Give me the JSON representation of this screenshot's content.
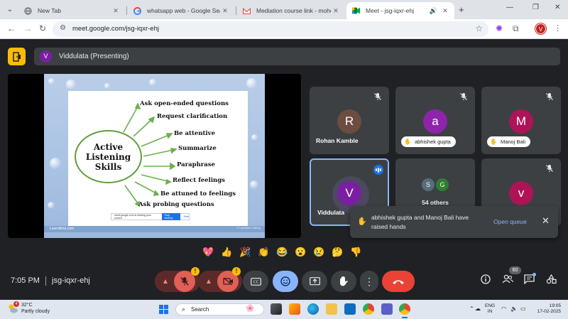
{
  "browser": {
    "tabs": [
      {
        "label": "New Tab"
      },
      {
        "label": "whatsapp web - Google Search"
      },
      {
        "label": "Mediation course link - mohod"
      },
      {
        "label": "Meet - jsg-iqxr-ehj"
      }
    ],
    "url": "meet.google.com/jsg-iqxr-ehj",
    "profile_initial": "V"
  },
  "meet": {
    "presenter_initial": "V",
    "presenter_label": "Viddulata (Presenting)",
    "slide": {
      "center_text": "Active\nListening\nSkills",
      "skills": [
        "Ask open-ended questions",
        "Request clarification",
        "Be attentive",
        "Summarize",
        "Paraphrase",
        "Reflect feelings",
        "Be attuned to feelings",
        "Ask probing questions"
      ],
      "share_bar_text": "meet.google.com is sharing your screen.",
      "share_stop": "Stop sharing",
      "share_hide": "Hide",
      "footer_left": "Learnitime.com",
      "footer_right": "© Learnitime   Training"
    },
    "participants": [
      {
        "name": "Rohan Kamble",
        "initial": "R",
        "color": "#6d4c41",
        "muted": true
      },
      {
        "name": "abhishek gupta",
        "initial": "a",
        "color": "#8e24aa",
        "muted": true,
        "hand_raised": true
      },
      {
        "name": "Manoj Bali",
        "initial": "M",
        "color": "#ad1457",
        "muted": true,
        "hand_raised": true
      },
      {
        "name": "Viddulata",
        "initial": "V",
        "color": "#7b1fa2",
        "speaking": true
      },
      {
        "name": "54 others",
        "initials": [
          "S",
          "G"
        ],
        "colors": [
          "#546e7a",
          "#2e7d32"
        ]
      },
      {
        "name": "",
        "initial": "v",
        "color": "#ad1457",
        "muted": true
      }
    ],
    "toast": {
      "message": "abhishek gupta and Manoj Bali have raised hands",
      "action": "Open queue"
    },
    "reactions": [
      "💖",
      "👍",
      "🎉",
      "👏",
      "😂",
      "😮",
      "😢",
      "🤔",
      "👎"
    ],
    "bottom": {
      "time": "7:05 PM",
      "meeting_code": "jsg-iqxr-ehj",
      "warning_mark": "!",
      "participant_count": "60"
    }
  },
  "taskbar": {
    "weather_temp": "32°C",
    "weather_desc": "Partly cloudy",
    "weather_badge": "4",
    "search_text": "Search",
    "lang_line1": "ENG",
    "lang_line2": "IN",
    "time": "19:05",
    "date": "17-02-2025"
  }
}
